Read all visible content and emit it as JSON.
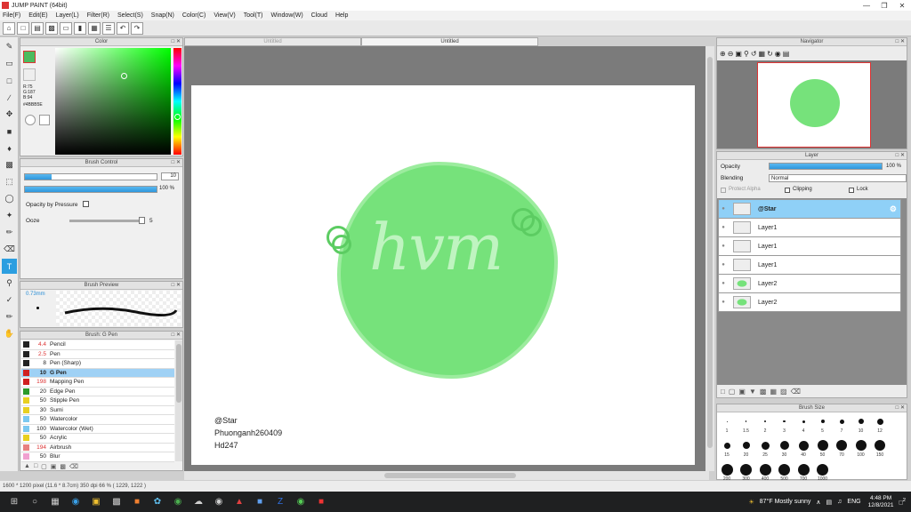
{
  "window": {
    "title": "JUMP PAINT (64bit)"
  },
  "menu": [
    "File(F)",
    "Edit(E)",
    "Layer(L)",
    "Filter(R)",
    "Select(S)",
    "Snap(N)",
    "Color(C)",
    "View(V)",
    "Tool(T)",
    "Window(W)",
    "Cloud",
    "Help"
  ],
  "color_panel": {
    "title": "Color",
    "r": "R:75",
    "g": "G:187",
    "b": "B:94",
    "hex": "#4BBB5E",
    "fg": "#4bbb5e",
    "bg": "#ffffff"
  },
  "brush_control": {
    "title": "Brush Control",
    "size": "10",
    "opacity": "100 %",
    "opacity_value": 100,
    "opacity_by_pressure": "Opacity by Pressure",
    "ooze": "Ooze",
    "ooze_value": "5"
  },
  "brush_preview": {
    "title": "Brush Preview",
    "size": "0.73mm"
  },
  "brush_list": {
    "title": "Brush: G Pen",
    "items": [
      {
        "size": "4.4",
        "name": "Pencil",
        "color": "#222222",
        "red": true
      },
      {
        "size": "2.5",
        "name": "Pen",
        "color": "#222222",
        "red": true
      },
      {
        "size": "8",
        "name": "Pen (Sharp)",
        "color": "#222222",
        "red": false
      },
      {
        "size": "10",
        "name": "G Pen",
        "color": "#d02020",
        "red": false,
        "selected": true
      },
      {
        "size": "198",
        "name": "Mapping Pen",
        "color": "#d02020",
        "red": true
      },
      {
        "size": "20",
        "name": "Edge Pen",
        "color": "#2a9a2a",
        "red": false
      },
      {
        "size": "50",
        "name": "Stipple Pen",
        "color": "#e8d020",
        "red": false
      },
      {
        "size": "30",
        "name": "Sumi",
        "color": "#e8d020",
        "red": false
      },
      {
        "size": "50",
        "name": "Watercolor",
        "color": "#7ac8f0",
        "red": false
      },
      {
        "size": "100",
        "name": "Watercolor (Wet)",
        "color": "#7ac8f0",
        "red": false
      },
      {
        "size": "50",
        "name": "Acrylic",
        "color": "#e8d020",
        "red": false
      },
      {
        "size": "194",
        "name": "Airbrush",
        "color": "#e88080",
        "red": true
      },
      {
        "size": "50",
        "name": "Blur",
        "color": "#f0a0d0",
        "red": false
      }
    ]
  },
  "tabs": [
    {
      "label": "Untitled",
      "active": false
    },
    {
      "label": "Untitled",
      "active": true
    }
  ],
  "canvas": {
    "lines": [
      "@Star",
      "Phuonganh260409",
      "Hd247"
    ],
    "art_text": "hvm"
  },
  "navigator": {
    "title": "Navigator"
  },
  "layer_panel": {
    "title": "Layer",
    "opacity_label": "Opacity",
    "opacity_value": "100 %",
    "blending_label": "Blending",
    "blending_value": "Normal",
    "protect_alpha": "Protect Alpha",
    "clipping": "Clipping",
    "lock": "Lock",
    "layers": [
      {
        "name": "@Star",
        "selected": true
      },
      {
        "name": "Layer1"
      },
      {
        "name": "Layer1"
      },
      {
        "name": "Layer1"
      },
      {
        "name": "Layer2"
      },
      {
        "name": "Layer2"
      }
    ]
  },
  "brush_size": {
    "title": "Brush Size",
    "sizes": [
      "1",
      "1.5",
      "2",
      "3",
      "4",
      "5",
      "7",
      "10",
      "12",
      "15",
      "20",
      "25",
      "30",
      "40",
      "50",
      "70",
      "100",
      "150",
      "200",
      "300",
      "400",
      "500",
      "700",
      "1000"
    ]
  },
  "status": {
    "text": "1600 * 1200 pixel  (11.6 * 8.7cm)  350 dpi  66 %  ( 1229, 1222 )"
  },
  "taskbar": {
    "weather": "87°F  Mostly sunny",
    "lang": "ENG",
    "time": "4:48 PM",
    "date": "12/8/2021",
    "notif": "2"
  }
}
